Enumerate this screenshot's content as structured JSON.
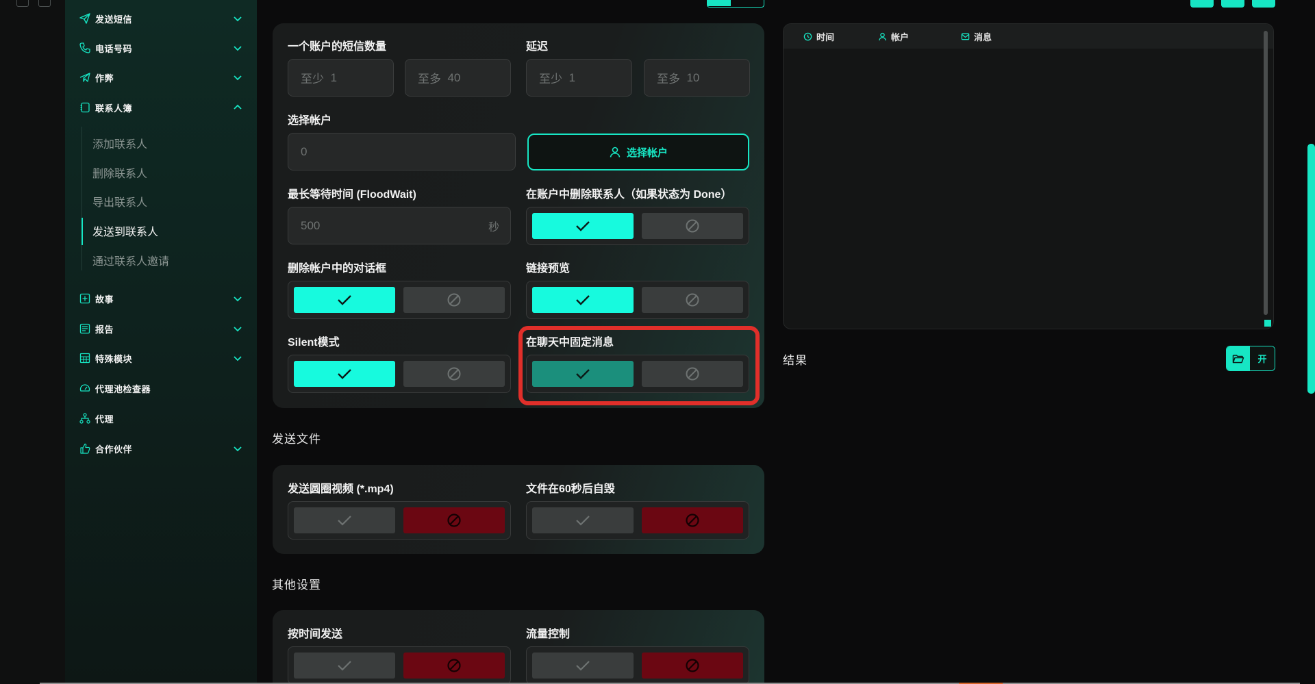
{
  "sidebar": {
    "items": [
      {
        "label": "发送短信",
        "icon": "send-icon"
      },
      {
        "label": "电话号码",
        "icon": "phone-icon"
      },
      {
        "label": "作弊",
        "icon": "paper-plane-icon"
      },
      {
        "label": "联系人簿",
        "icon": "contact-book-icon"
      },
      {
        "label": "故事",
        "icon": "plus-square-icon"
      },
      {
        "label": "报告",
        "icon": "report-icon"
      },
      {
        "label": "特殊模块",
        "icon": "grid-icon"
      },
      {
        "label": "代理池检查器",
        "icon": "gauge-icon"
      },
      {
        "label": "代理",
        "icon": "network-icon"
      },
      {
        "label": "合作伙伴",
        "icon": "thumb-up-icon"
      }
    ],
    "sub_items": [
      "添加联系人",
      "删除联系人",
      "导出联系人",
      "发送到联系人",
      "通过联系人邀请"
    ],
    "active_sub": "发送到联系人"
  },
  "form": {
    "sms_per_account": {
      "label": "一个账户的短信数量",
      "min_placeholder": "至少",
      "min_value": "1",
      "max_placeholder": "至多",
      "max_value": "40"
    },
    "delay": {
      "label": "延迟",
      "min_placeholder": "至少",
      "min_value": "1",
      "max_placeholder": "至多",
      "max_value": "10"
    },
    "select_account": {
      "label": "选择帐户",
      "value": "0",
      "button_label": "选择帐户"
    },
    "flood_wait": {
      "label": "最长等待时间 (FloodWait)",
      "value": "500",
      "unit": "秒"
    },
    "delete_contacts": {
      "label": "在账户中删除联系人（如果状态为 Done）",
      "enabled": true
    },
    "delete_dialogs": {
      "label": "删除帐户中的对话框",
      "enabled": true
    },
    "link_preview": {
      "label": "链接预览",
      "enabled": true
    },
    "silent_mode": {
      "label": "Silent模式",
      "enabled": true
    },
    "pin_message": {
      "label": "在聊天中固定消息",
      "enabled": true
    }
  },
  "send_files": {
    "title": "发送文件",
    "round_video": {
      "label": "发送圆圈视频 (*.mp4)",
      "enabled": false
    },
    "self_destruct": {
      "label": "文件在60秒后自毁",
      "enabled": false
    }
  },
  "other_settings": {
    "title": "其他设置",
    "send_by_time": {
      "label": "按时间发送",
      "enabled": false
    },
    "traffic_control": {
      "label": "流量控制",
      "enabled": false
    }
  },
  "log": {
    "columns": [
      {
        "label": "时间",
        "icon": "clock-icon"
      },
      {
        "label": "帐户",
        "icon": "user-icon"
      },
      {
        "label": "消息",
        "icon": "mail-icon"
      }
    ]
  },
  "result": {
    "label": "结果",
    "open_label": "开"
  },
  "colors": {
    "accent": "#17fade",
    "danger": "#6b0712",
    "highlight": "#e02f2a"
  }
}
